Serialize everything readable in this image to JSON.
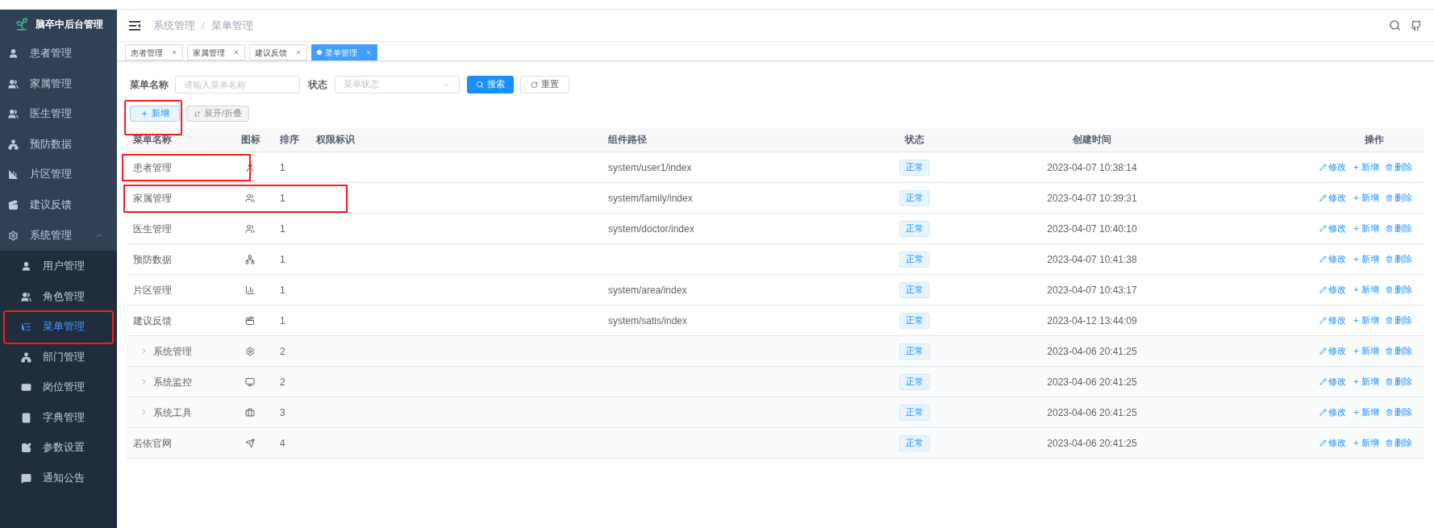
{
  "sidebar": {
    "title": "脑卒中后台管理",
    "items": [
      {
        "label": "患者管理",
        "selected": false,
        "highlighted": false
      },
      {
        "label": "家属管理",
        "selected": false,
        "highlighted": false
      },
      {
        "label": "医生管理",
        "selected": false,
        "highlighted": false
      },
      {
        "label": "预防数据",
        "selected": false,
        "highlighted": false
      },
      {
        "label": "片区管理",
        "selected": false,
        "highlighted": false
      },
      {
        "label": "建议反馈",
        "selected": false,
        "highlighted": false
      },
      {
        "label": "系统管理",
        "selected": false,
        "highlighted": false,
        "expanded": true,
        "children": [
          {
            "label": "用户管理",
            "selected": false,
            "highlighted": false
          },
          {
            "label": "角色管理",
            "selected": false,
            "highlighted": false
          },
          {
            "label": "菜单管理",
            "selected": true,
            "highlighted": true
          },
          {
            "label": "部门管理",
            "selected": false,
            "highlighted": false
          },
          {
            "label": "岗位管理",
            "selected": false,
            "highlighted": false
          },
          {
            "label": "字典管理",
            "selected": false,
            "highlighted": false
          },
          {
            "label": "参数设置",
            "selected": false,
            "highlighted": false
          },
          {
            "label": "通知公告",
            "selected": false,
            "highlighted": false
          }
        ]
      }
    ]
  },
  "breadcrumb": {
    "items": [
      "系统管理",
      "菜单管理"
    ],
    "separator": "/"
  },
  "tabs": [
    {
      "label": "患者管理",
      "selected": false
    },
    {
      "label": "家属管理",
      "selected": false
    },
    {
      "label": "建议反馈",
      "selected": false
    },
    {
      "label": "菜单管理",
      "selected": true
    }
  ],
  "search": {
    "name_label": "菜单名称",
    "name_placeholder": "请输入菜单名称",
    "status_label": "状态",
    "status_placeholder": "菜单状态",
    "search_button": "搜索",
    "reset_button": "重置"
  },
  "toolbar": {
    "add_button": "新增",
    "add_highlighted": true,
    "toggle_button": "展开/折叠"
  },
  "table": {
    "columns": [
      "菜单名称",
      "图标",
      "排序",
      "权限标识",
      "组件路径",
      "状态",
      "创建时间",
      "操作"
    ],
    "rows": [
      {
        "name": "患者管理",
        "has_children": false,
        "sort": "1",
        "path": "system/user1/index",
        "status": "正常",
        "created": "2023-04-07 10:38:14",
        "actions": [
          "修改",
          "新增",
          "删除"
        ],
        "highlighted": true
      },
      {
        "name": "家属管理",
        "has_children": false,
        "sort": "1",
        "path": "system/family/index",
        "status": "正常",
        "created": "2023-04-07 10:39:31",
        "actions": [
          "修改",
          "新增",
          "删除"
        ],
        "highlighted": true
      },
      {
        "name": "医生管理",
        "has_children": false,
        "sort": "1",
        "path": "system/doctor/index",
        "status": "正常",
        "created": "2023-04-07 10:40:10",
        "actions": [
          "修改",
          "新增",
          "删除"
        ],
        "highlighted": false
      },
      {
        "name": "预防数据",
        "has_children": false,
        "sort": "1",
        "status": "正常",
        "created": "2023-04-07 10:41:38",
        "actions": [
          "修改",
          "新增",
          "删除"
        ],
        "highlighted": false
      },
      {
        "name": "片区管理",
        "has_children": false,
        "sort": "1",
        "path": "system/area/index",
        "status": "正常",
        "created": "2023-04-07 10:43:17",
        "actions": [
          "修改",
          "新增",
          "删除"
        ],
        "highlighted": false
      },
      {
        "name": "建议反馈",
        "has_children": false,
        "sort": "1",
        "path": "system/satis/index",
        "status": "正常",
        "created": "2023-04-12 13:44:09",
        "actions": [
          "修改",
          "新增",
          "删除"
        ],
        "highlighted": false
      },
      {
        "name": "系统管理",
        "has_children": true,
        "sort": "2",
        "status": "正常",
        "created": "2023-04-06 20:41:25",
        "actions": [
          "修改",
          "新增",
          "删除"
        ],
        "highlighted": false
      },
      {
        "name": "系统监控",
        "has_children": true,
        "sort": "2",
        "status": "正常",
        "created": "2023-04-06 20:41:25",
        "actions": [
          "修改",
          "新增",
          "删除"
        ],
        "highlighted": false
      },
      {
        "name": "系统工具",
        "has_children": true,
        "sort": "3",
        "status": "正常",
        "created": "2023-04-06 20:41:25",
        "actions": [
          "修改",
          "新增",
          "删除"
        ],
        "highlighted": false
      },
      {
        "name": "若依官网",
        "has_children": false,
        "sort": "4",
        "status": "正常",
        "created": "2023-04-06 20:41:25",
        "actions": [
          "修改",
          "新增",
          "删除"
        ],
        "highlighted": false
      }
    ]
  }
}
